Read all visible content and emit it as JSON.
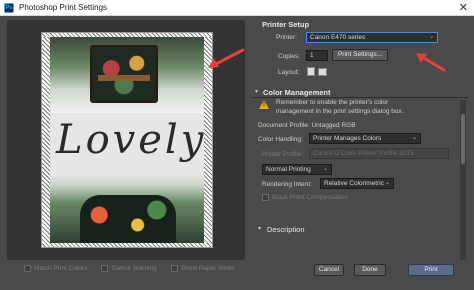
{
  "window": {
    "title": "Photoshop Print Settings",
    "app_icon_text": "Ps"
  },
  "preview": {
    "image_text": "Lovely",
    "options": [
      {
        "label": "Match Print Colors"
      },
      {
        "label": "Gamut Warning"
      },
      {
        "label": "Show Paper White"
      }
    ]
  },
  "printer_setup": {
    "title": "Printer Setup",
    "printer_label": "Printer:",
    "printer_value": "Canon E470 series",
    "copies_label": "Copies:",
    "copies_value": "1",
    "print_settings_button": "Print Settings...",
    "layout_label": "Layout:"
  },
  "color_management": {
    "title": "Color Management",
    "warning_line1": "Remember to enable the printer's color",
    "warning_line2": "management in the print settings dialog box.",
    "document_profile": "Document Profile: Untagged RGB",
    "color_handling_label": "Color Handling:",
    "color_handling_value": "Printer Manages Colors",
    "printer_profile_label": "Printer Profile:",
    "printer_profile_value": "Canon IJ Color Printer Profile 2015",
    "normal_printing": "Normal Printing",
    "rendering_intent_label": "Rendering Intent:",
    "rendering_intent_value": "Relative Colorimetric",
    "black_point": "Black Point Compensation"
  },
  "description": {
    "title": "Description"
  },
  "footer": {
    "cancel": "Cancel",
    "done": "Done",
    "print": "Print"
  },
  "colors": {
    "background": "#4a4a4a",
    "accent": "#3d8ee8",
    "arrow": "#e8413c",
    "warning": "#e8b010"
  }
}
